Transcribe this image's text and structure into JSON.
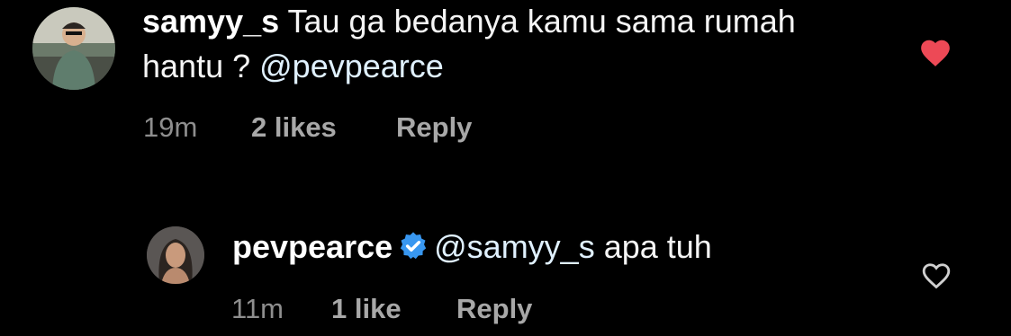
{
  "comments": [
    {
      "username": "samyy_s",
      "text": "Tau ga bedanya kamu sama rumah hantu ?",
      "mention": "@pevpearce",
      "time": "19m",
      "likes": "2 likes",
      "reply": "Reply",
      "liked": true
    },
    {
      "username": "pevpearce",
      "mention": "@samyy_s",
      "text": "apa tuh",
      "time": "11m",
      "likes": "1 like",
      "reply": "Reply",
      "verified": true,
      "liked": false
    }
  ],
  "colors": {
    "background": "#000000",
    "heart_liked": "#ed4956",
    "verified_badge": "#3897f0",
    "secondary_text": "#8e8e8e"
  },
  "icons": [
    "heart-filled-icon",
    "heart-outline-icon",
    "verified-badge-icon"
  ]
}
